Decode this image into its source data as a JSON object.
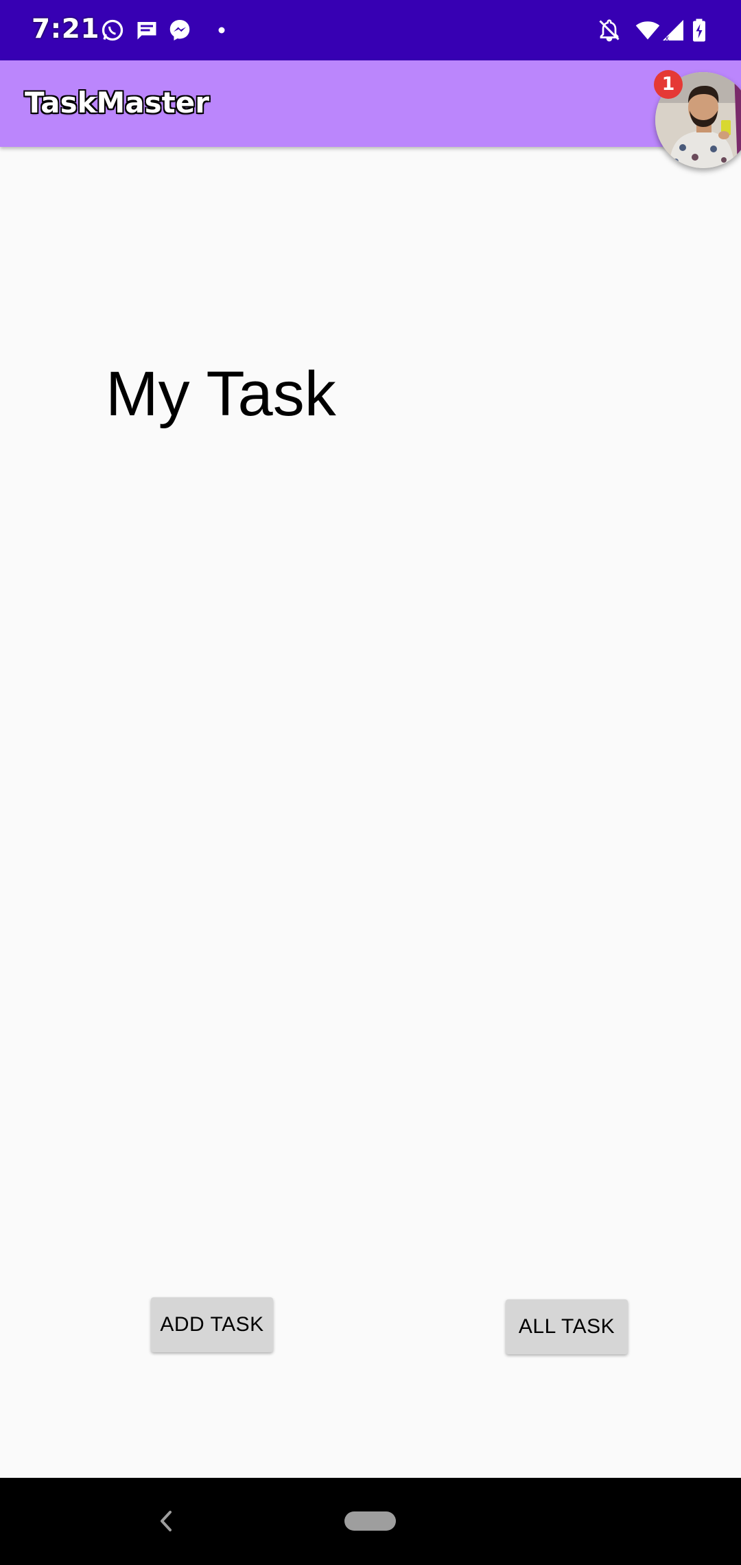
{
  "status_bar": {
    "time": "7:21",
    "icons": [
      "whatsapp-icon",
      "message-icon",
      "messenger-icon",
      "dot-icon",
      "notifications-off-icon",
      "wifi-icon",
      "signal-icon",
      "battery-charging-icon"
    ],
    "color": "#3700b3"
  },
  "app_bar": {
    "title": "TaskMaster",
    "color": "#bb86fc"
  },
  "chat_head": {
    "badge_count": "1",
    "icon": "chat-head-avatar"
  },
  "main": {
    "heading": "My Task"
  },
  "buttons": {
    "add_task": "ADD TASK",
    "all_task": "ALL TASK"
  },
  "nav_bar": {
    "icons": [
      "back-icon",
      "home-pill-icon"
    ]
  }
}
